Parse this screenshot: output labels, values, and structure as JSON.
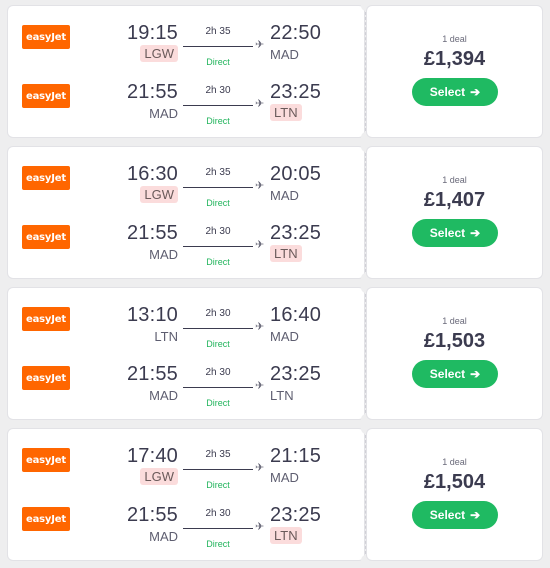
{
  "deals": [
    {
      "deal_count": "1 deal",
      "price": "£1,394",
      "select_label": "Select",
      "legs": [
        {
          "airline": "easyJet",
          "dep_time": "19:15",
          "dep_code": "LGW",
          "dep_hl": true,
          "duration": "2h 35",
          "stops": "Direct",
          "arr_time": "22:50",
          "arr_code": "MAD",
          "arr_hl": false
        },
        {
          "airline": "easyJet",
          "dep_time": "21:55",
          "dep_code": "MAD",
          "dep_hl": false,
          "duration": "2h 30",
          "stops": "Direct",
          "arr_time": "23:25",
          "arr_code": "LTN",
          "arr_hl": true
        }
      ]
    },
    {
      "deal_count": "1 deal",
      "price": "£1,407",
      "select_label": "Select",
      "legs": [
        {
          "airline": "easyJet",
          "dep_time": "16:30",
          "dep_code": "LGW",
          "dep_hl": true,
          "duration": "2h 35",
          "stops": "Direct",
          "arr_time": "20:05",
          "arr_code": "MAD",
          "arr_hl": false
        },
        {
          "airline": "easyJet",
          "dep_time": "21:55",
          "dep_code": "MAD",
          "dep_hl": false,
          "duration": "2h 30",
          "stops": "Direct",
          "arr_time": "23:25",
          "arr_code": "LTN",
          "arr_hl": true
        }
      ]
    },
    {
      "deal_count": "1 deal",
      "price": "£1,503",
      "select_label": "Select",
      "legs": [
        {
          "airline": "easyJet",
          "dep_time": "13:10",
          "dep_code": "LTN",
          "dep_hl": false,
          "duration": "2h 30",
          "stops": "Direct",
          "arr_time": "16:40",
          "arr_code": "MAD",
          "arr_hl": false
        },
        {
          "airline": "easyJet",
          "dep_time": "21:55",
          "dep_code": "MAD",
          "dep_hl": false,
          "duration": "2h 30",
          "stops": "Direct",
          "arr_time": "23:25",
          "arr_code": "LTN",
          "arr_hl": false
        }
      ]
    },
    {
      "deal_count": "1 deal",
      "price": "£1,504",
      "select_label": "Select",
      "legs": [
        {
          "airline": "easyJet",
          "dep_time": "17:40",
          "dep_code": "LGW",
          "dep_hl": true,
          "duration": "2h 35",
          "stops": "Direct",
          "arr_time": "21:15",
          "arr_code": "MAD",
          "arr_hl": false
        },
        {
          "airline": "easyJet",
          "dep_time": "21:55",
          "dep_code": "MAD",
          "dep_hl": false,
          "duration": "2h 30",
          "stops": "Direct",
          "arr_time": "23:25",
          "arr_code": "LTN",
          "arr_hl": true
        }
      ]
    }
  ],
  "icons": {
    "plane": "plane-icon",
    "arrow": "arrow-right-icon"
  },
  "colors": {
    "airline_brand": "#ff6600",
    "select_button": "#1fba62",
    "direct": "#22b45c",
    "airport_highlight": "#fbdcdc"
  }
}
